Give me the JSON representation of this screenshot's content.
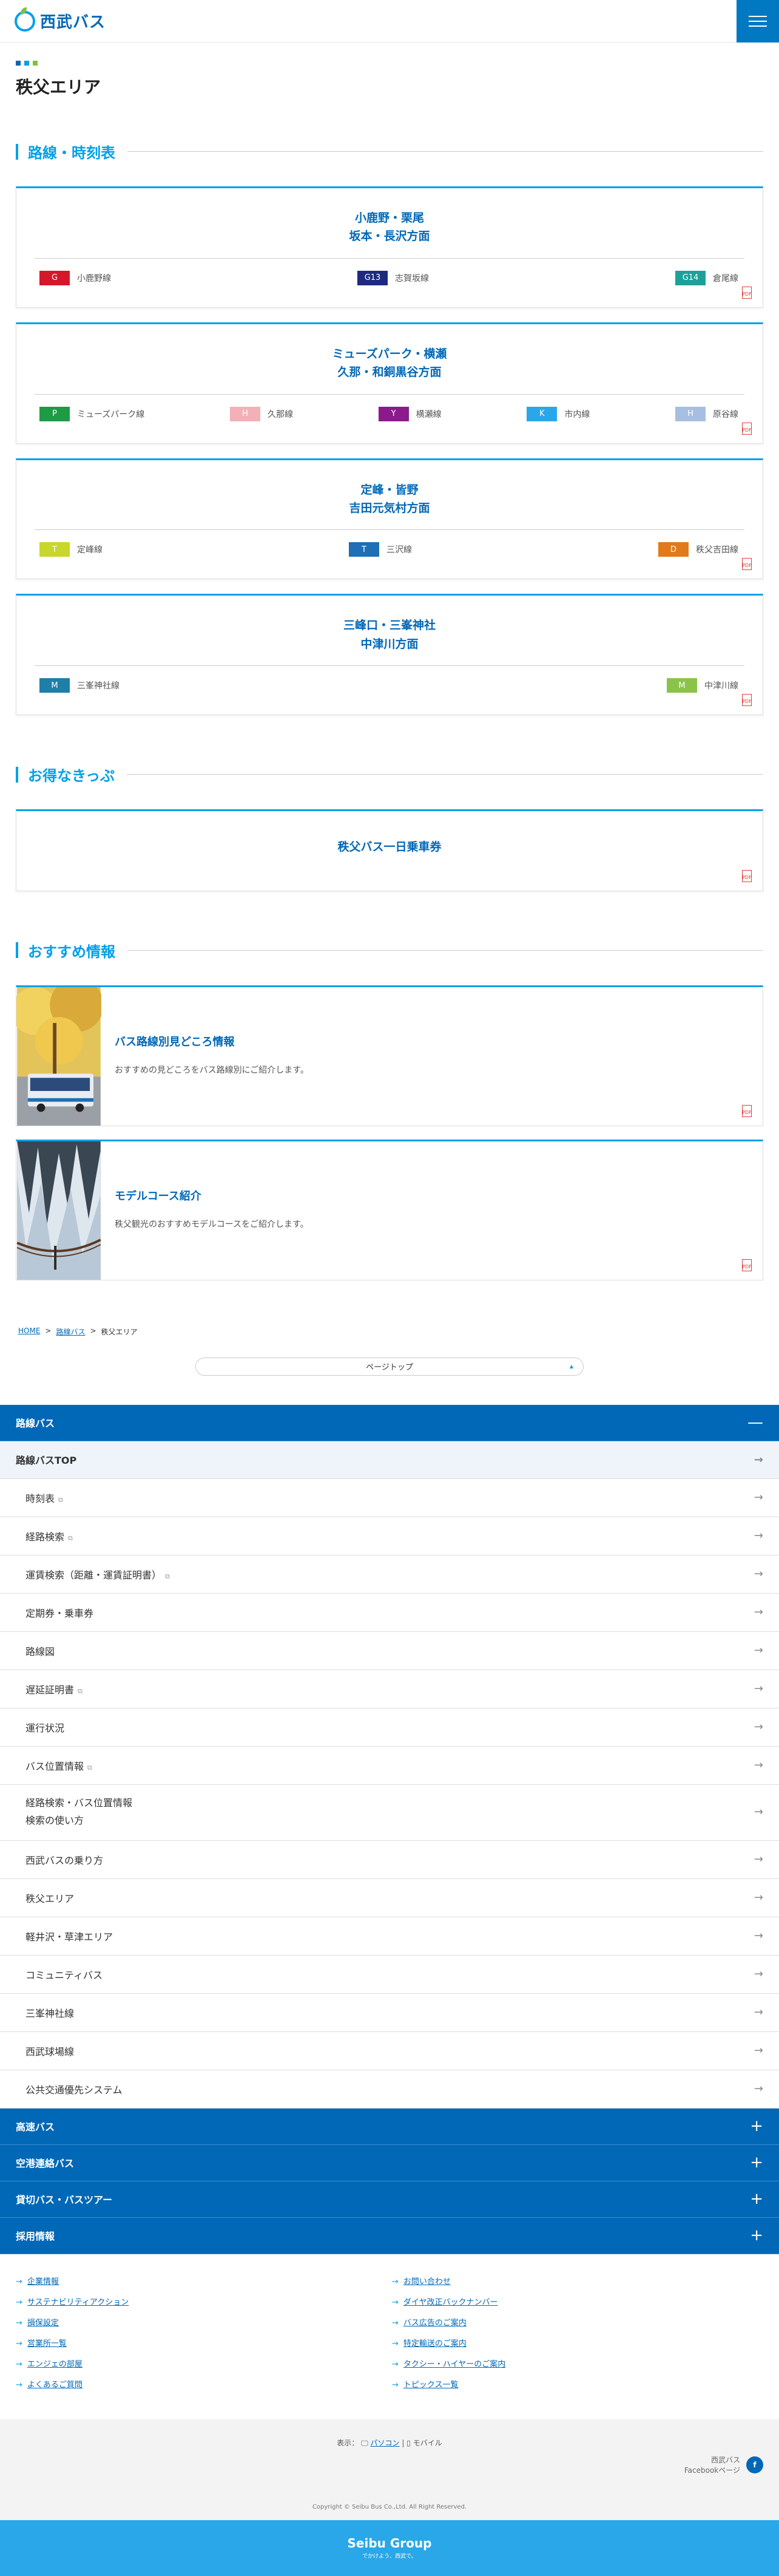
{
  "header": {
    "logo_text": "西武バス"
  },
  "page_title": "秩父エリア",
  "colors": {
    "accent": "#00a0e9",
    "brand": "#0068b7",
    "dot1": "#0068b7",
    "dot2": "#00a0e9",
    "dot3": "#7cc242"
  },
  "sections": {
    "routes": "路線・時刻表",
    "tickets": "お得なきっぷ",
    "recommend": "おすすめ情報"
  },
  "route_cards": [
    {
      "title1": "小鹿野・栗尾",
      "title2": "坂本・長沢方面",
      "lines": [
        {
          "code": "G",
          "name": "小鹿野線",
          "color": "#d5172a"
        },
        {
          "code": "G13",
          "name": "志賀坂線",
          "color": "#1d2a80"
        },
        {
          "code": "G14",
          "name": "倉尾線",
          "color": "#1ea09a"
        }
      ]
    },
    {
      "title1": "ミューズパーク・横瀬",
      "title2": "久那・和銅黒谷方面",
      "lines": [
        {
          "code": "P",
          "name": "ミューズパーク線",
          "color": "#1f9a45"
        },
        {
          "code": "H",
          "name": "久那線",
          "color": "#f2b1b6"
        },
        {
          "code": "Y",
          "name": "横瀬線",
          "color": "#8b1a8a"
        },
        {
          "code": "K",
          "name": "市内線",
          "color": "#2aa7e8"
        },
        {
          "code": "H",
          "name": "原谷線",
          "color": "#a6bfe0"
        }
      ]
    },
    {
      "title1": "定峰・皆野",
      "title2": "吉田元気村方面",
      "lines": [
        {
          "code": "T",
          "name": "定峰線",
          "color": "#c9d62a"
        },
        {
          "code": "T",
          "name": "三沢線",
          "color": "#1e6fb5"
        },
        {
          "code": "D",
          "name": "秩父吉田線",
          "color": "#e07a1b"
        }
      ]
    },
    {
      "title1": "三峰口・三峯神社",
      "title2": "中津川方面",
      "lines": [
        {
          "code": "M",
          "name": "三峯神社線",
          "color": "#1f7fa8"
        },
        {
          "code": "M",
          "name": "中津川線",
          "color": "#8bc34a"
        }
      ]
    }
  ],
  "ticket_card": {
    "title": "秩父バス一日乗車券"
  },
  "recommend": [
    {
      "title": "バス路線別見どころ情報",
      "desc": "おすすめの見どころをバス路線別にご紹介します。"
    },
    {
      "title": "モデルコース紹介",
      "desc": "秩父観光のおすすめモデルコースをご紹介します。"
    }
  ],
  "breadcrumb": {
    "home": "HOME",
    "sep": ">",
    "level2": "路線バス",
    "current": "秩父エリア"
  },
  "pagetop": "ページトップ",
  "footer_nav": {
    "route_bus": "路線バス",
    "route_bus_top": "路線バスTOP",
    "items": [
      "時刻表",
      "経路検索",
      "運賃検索（距離・運賃証明書）",
      "定期券・乗車券",
      "路線図",
      "遅延証明書",
      "運行状況",
      "バス位置情報"
    ],
    "item_tall_line1": "経路検索・バス位置情報",
    "item_tall_line2": "検索の使い方",
    "items2": [
      "西武バスの乗り方",
      "秩父エリア",
      "軽井沢・草津エリア",
      "コミュニティバス",
      "三峯神社線",
      "西武球場線",
      "公共交通優先システム"
    ],
    "collapsed": [
      "高速バス",
      "空港連絡バス",
      "貸切バス・バスツアー",
      "採用情報"
    ]
  },
  "links_left": [
    "企業情報",
    "サステナビリティアクション",
    "損保設定",
    "営業所一覧",
    "エンジェの部屋",
    "よくあるご質問"
  ],
  "links_right": [
    "お問い合わせ",
    "ダイヤ改正バックナンバー",
    "バス広告のご案内",
    "特定輸送のご案内",
    "タクシー・ハイヤーのご案内",
    "トピックス一覧"
  ],
  "display": {
    "label": "表示：",
    "pc": "パソコン",
    "sep": "|",
    "mobile": "モバイル"
  },
  "facebook": {
    "line1": "西武バス",
    "line2": "Facebookページ",
    "icon": "f"
  },
  "copyright": "Copyright © Seibu Bus Co.,Ltd. All Right Reserved.",
  "group": {
    "name": "Seibu Group",
    "tagline": "でかけよう、西武で。"
  }
}
